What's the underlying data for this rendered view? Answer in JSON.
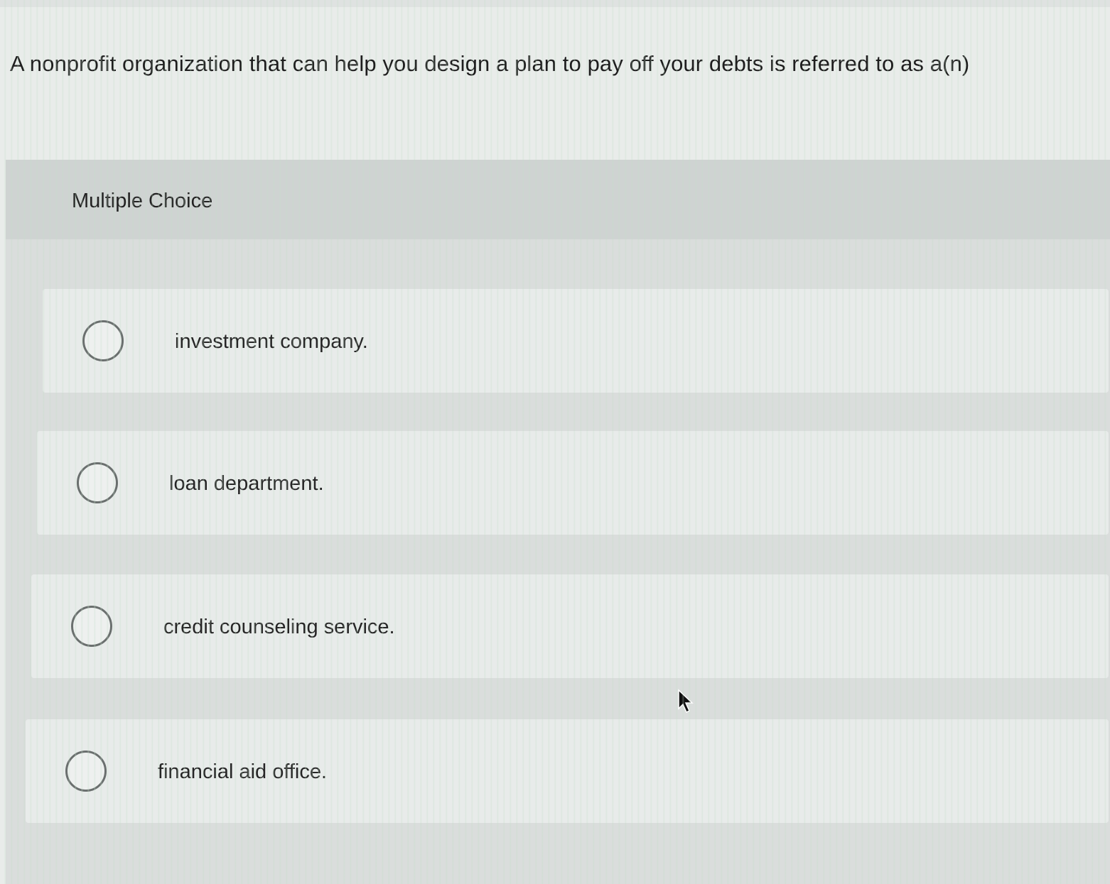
{
  "question": {
    "text": "A nonprofit organization that can help you design a plan to pay off your debts is referred to as a(n)"
  },
  "multiple_choice": {
    "title": "Multiple Choice",
    "options": [
      {
        "label": "investment company.",
        "selected": false
      },
      {
        "label": "loan department.",
        "selected": false
      },
      {
        "label": "credit counseling service.",
        "selected": false
      },
      {
        "label": "financial aid office.",
        "selected": false
      }
    ]
  },
  "icons": {
    "radio": "radio-button-icon",
    "cursor": "mouse-pointer-icon"
  },
  "colors": {
    "background": "#e9ecea",
    "panel": "#dadddc",
    "header": "#cfd3d2",
    "option": "#e8ebea",
    "radio_border": "#6a6f6e"
  }
}
